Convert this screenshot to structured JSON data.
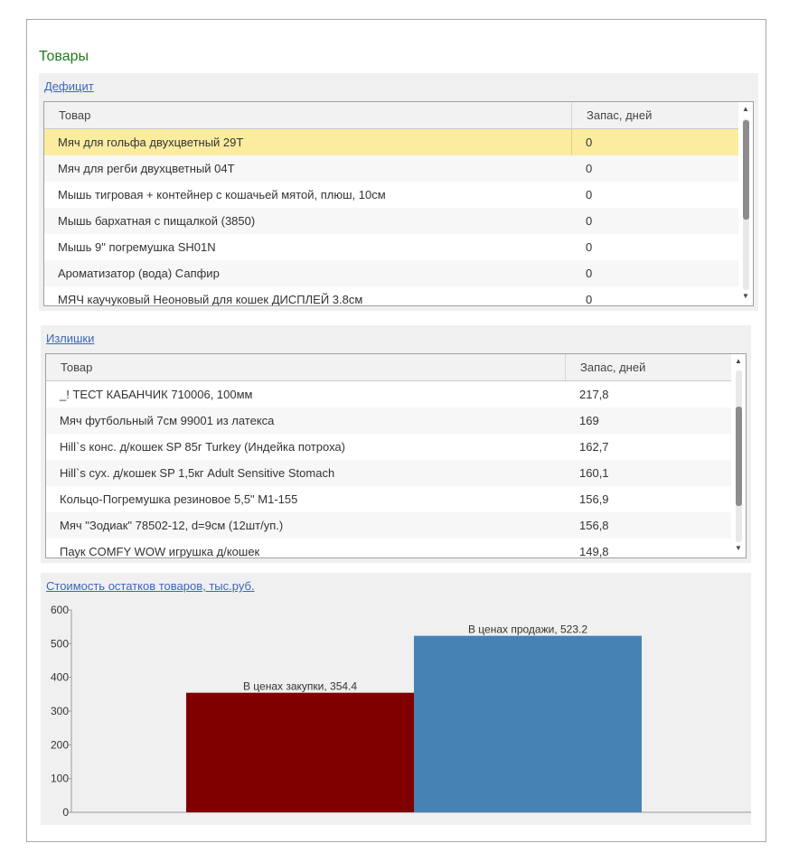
{
  "page": {
    "title": "Товары"
  },
  "deficit": {
    "link": "Дефицит",
    "columns": [
      "Товар",
      "Запас, дней"
    ],
    "rows": [
      {
        "name": "Мяч для гольфа двухцветный 29Т",
        "stock": "0"
      },
      {
        "name": "Мяч для регби двухцветный 04Т",
        "stock": "0"
      },
      {
        "name": "Мышь тигровая + контейнер с кошачьей мятой, плюш, 10см",
        "stock": "0"
      },
      {
        "name": "Мышь бархатная с пищалкой (3850)",
        "stock": "0"
      },
      {
        "name": "Мышь 9\" погремушка SH01N",
        "stock": "0"
      },
      {
        "name": "Ароматизатор (вода) Сапфир",
        "stock": "0"
      },
      {
        "name": "МЯЧ каучуковый Неоновый для кошек ДИСПЛЕЙ 3.8см",
        "stock": "0"
      }
    ]
  },
  "surplus": {
    "link": "Излишки",
    "columns": [
      "Товар",
      "Запас, дней"
    ],
    "rows": [
      {
        "name": "_! ТЕСТ КАБАНЧИК 710006, 100мм",
        "stock": "217,8"
      },
      {
        "name": "Мяч футбольный 7см 99001 из латекса",
        "stock": "169"
      },
      {
        "name": "Hill`s конс. д/кошек SP 85г Turkey (Индейка потроха)",
        "stock": "162,7"
      },
      {
        "name": "Hill`s сух. д/кошек SP 1,5кг Adult Sensitive Stomach",
        "stock": "160,1"
      },
      {
        "name": "Кольцо-Погремушка резиновое 5,5\"  М1-155",
        "stock": "156,9"
      },
      {
        "name": "Мяч \"Зодиак\" 78502-12, d=9см (12шт/уп.)",
        "stock": "156,8"
      },
      {
        "name": "Паук COMFY WOW игрушка д/кошек",
        "stock": "149,8"
      }
    ]
  },
  "icons": {
    "scroll_up": "triangle-up-icon",
    "scroll_down": "triangle-down-icon"
  },
  "colors": {
    "title_green": "#1f7a1f",
    "link_blue": "#3b67b7",
    "selection": "#fbeca0"
  },
  "chart_data": {
    "type": "bar",
    "title": "Стоимость остатков товаров, тыс.руб.",
    "categories": [
      "В ценах закупки",
      "В ценах продажи"
    ],
    "values": [
      354.4,
      523.2
    ],
    "data_labels": [
      "В ценах закупки, 354.4",
      "В ценах продажи, 523.2"
    ],
    "colors": [
      "#800000",
      "#4682b4"
    ],
    "ylim": [
      0,
      600
    ],
    "yticks": [
      0,
      100,
      200,
      300,
      400,
      500,
      600
    ],
    "grid": false,
    "legend": "none"
  }
}
